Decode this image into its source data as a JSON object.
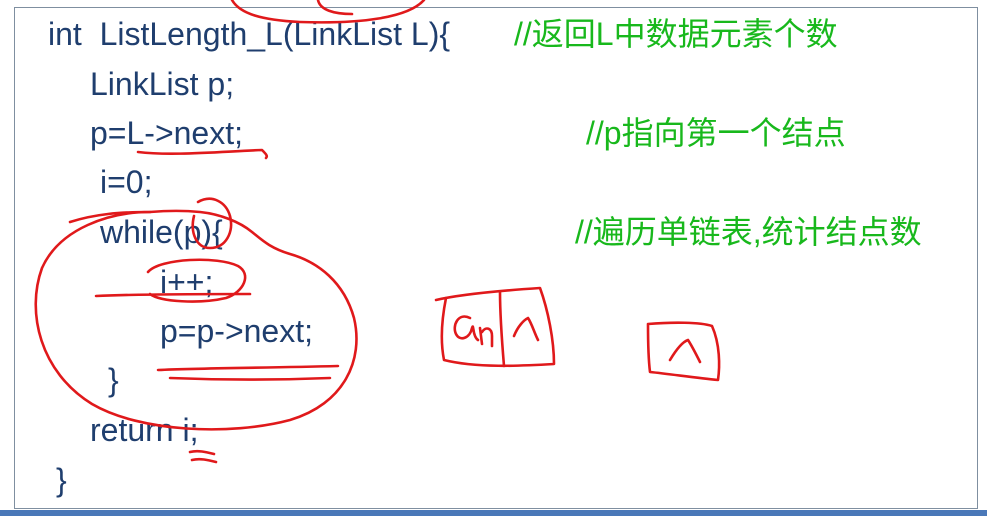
{
  "code": {
    "line1": "int  ListLength_L(LinkList L){",
    "line2": "LinkList p;",
    "line3": "p=L->next;",
    "line4": "i=0;",
    "line5": "while(p){",
    "line6": "i++;",
    "line7": "p=p->next;",
    "line8": "}",
    "line9": "return i;",
    "line10": "}"
  },
  "comments": {
    "c1": "//返回L中数据元素个数",
    "c3": "//p指向第一个结点",
    "c5": "//遍历单链表,统计结点数"
  },
  "colors": {
    "code": "#1f3e6e",
    "comment": "#18b81c",
    "annotation": "#e0191b",
    "frame": "#7f8fa0",
    "bar": "#4a78b8"
  }
}
